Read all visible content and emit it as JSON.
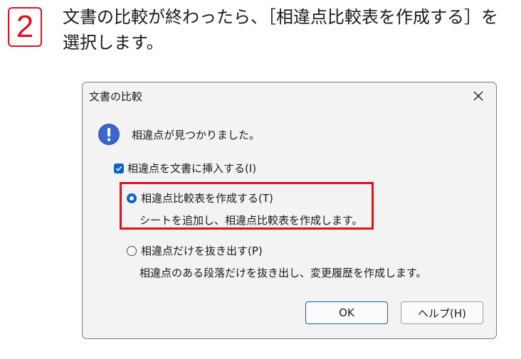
{
  "step": {
    "number": "2",
    "instruction_line1": "文書の比較が終わったら、［相違点比較表を作成する］を",
    "instruction_line2": "選択します。"
  },
  "dialog": {
    "title": "文書の比較",
    "message": "相違点が見つかりました。",
    "checkbox_label": "相違点を文書に挿入する(I)",
    "checkbox_checked": true,
    "options": [
      {
        "label": "相違点比較表を作成する(T)",
        "description": "シートを追加し、相違点比較表を作成します。",
        "selected": true
      },
      {
        "label": "相違点だけを抜き出す(P)",
        "description": "相違点のある段落だけを抜き出し、変更履歴を作成します。",
        "selected": false
      }
    ],
    "ok_label": "OK",
    "help_label": "ヘルプ(H)"
  },
  "icons": {
    "info": "exclamation-icon",
    "close": "close-icon",
    "check": "checkmark-icon"
  },
  "colors": {
    "accent_red": "#e0101e",
    "accent_blue": "#0a63c9",
    "dialog_bg": "#f3f3f3"
  }
}
